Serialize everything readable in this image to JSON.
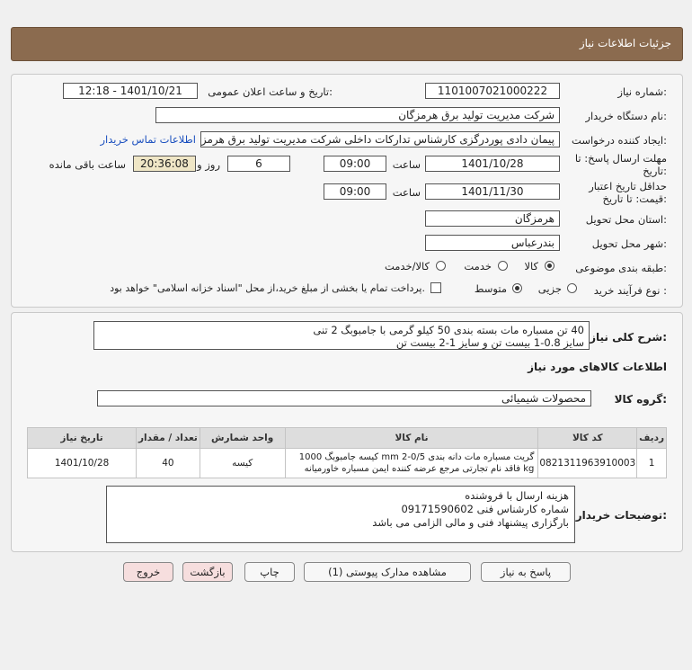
{
  "page_title": "جزئیات اطلاعات نیاز",
  "fields": {
    "need_number_label": "شماره نیاز:",
    "need_number": "1101007021000222",
    "announce_label": "تاریخ و ساعت اعلان عمومی:",
    "announce_value": "1401/10/21 - 12:18",
    "buyer_org_label": "نام دستگاه خریدار:",
    "buyer_org": "شرکت مدیریت تولید برق هرمزگان",
    "creator_label": "ایجاد کننده درخواست:",
    "creator": "پیمان دادی پوردرگزی کارشناس تدارکات داخلی شرکت مدیریت تولید برق هرمزگان",
    "contact_link": "اطلاعات تماس خریدار",
    "deadline_label_1": "مهلت ارسال پاسخ: تا",
    "deadline_label_2": "تاریخ:",
    "deadline_date": "1401/10/28",
    "time_label": "ساعت",
    "deadline_time": "09:00",
    "days_value": "6",
    "days_label": "روز و",
    "remaining_time": "20:36:08",
    "remaining_label": "ساعت باقی مانده",
    "validity_label_1": "حداقل تاریخ اعتبار",
    "validity_label_2": "قیمت: تا تاریخ:",
    "validity_date": "1401/11/30",
    "validity_time_label": "ساعت",
    "validity_time": "09:00",
    "province_label": "استان محل تحویل:",
    "province": "هرمزگان",
    "city_label": "شهر محل تحویل:",
    "city": "بندرعباس",
    "category_label": "طبقه بندی موضوعی:",
    "category_options": [
      "کالا",
      "خدمت",
      "کالا/خدمت"
    ],
    "process_label": "نوع فرآیند خرید :",
    "process_options": [
      "جزیی",
      "متوسط"
    ],
    "payment_note": "پرداخت تمام یا بخشی از مبلغ خرید،از محل \"اسناد خزانه اسلامی\" خواهد بود."
  },
  "summary": {
    "label": "شرح کلی نیاز:",
    "line1": "40 تن مسباره مات بسته بندی 50 کیلو گرمی با جامبوبگ 2 تنی",
    "line2": "سایز 0.8-1   بیست تن    و   سایز 1-2    بیست تن"
  },
  "goods_info_title": "اطلاعات کالاهای مورد نیاز",
  "goods_group_label": "گروه کالا:",
  "goods_group": "محصولات شیمیائی",
  "table": {
    "headers": [
      "ردیف",
      "کد کالا",
      "نام کالا",
      "واحد شمارش",
      "تعداد / مقدار",
      "تاریخ نیاز"
    ],
    "rows": [
      {
        "row": "1",
        "code": "0821311963910003",
        "name_line1": "گریت مسباره مات دانه بندی mm 2-0/5 کیسه جامبوبگ 1000",
        "name_line2": "kg فاقد نام تجارتی مرجع عرضه کننده ایمن مسباره خاورمیانه",
        "unit": "کیسه",
        "qty": "40",
        "date": "1401/10/28"
      }
    ]
  },
  "buyer_notes": {
    "label": "توضیحات خریدار:",
    "line1": "هزینه ارسال با فروشنده",
    "line2": "شماره کارشناس فنی 09171590602",
    "line3": "بارگزاری پیشنهاد فنی و مالی الزامی می باشد"
  },
  "buttons": {
    "reply": "پاسخ به نیاز",
    "attachments": "مشاهده مدارک پیوستی (1)",
    "print": "چاپ",
    "back": "بازگشت",
    "exit": "خروج"
  },
  "colors": {
    "header": "#8b6b4f",
    "link": "#1a4fbf",
    "remaining_bg": "#efe6c6"
  }
}
